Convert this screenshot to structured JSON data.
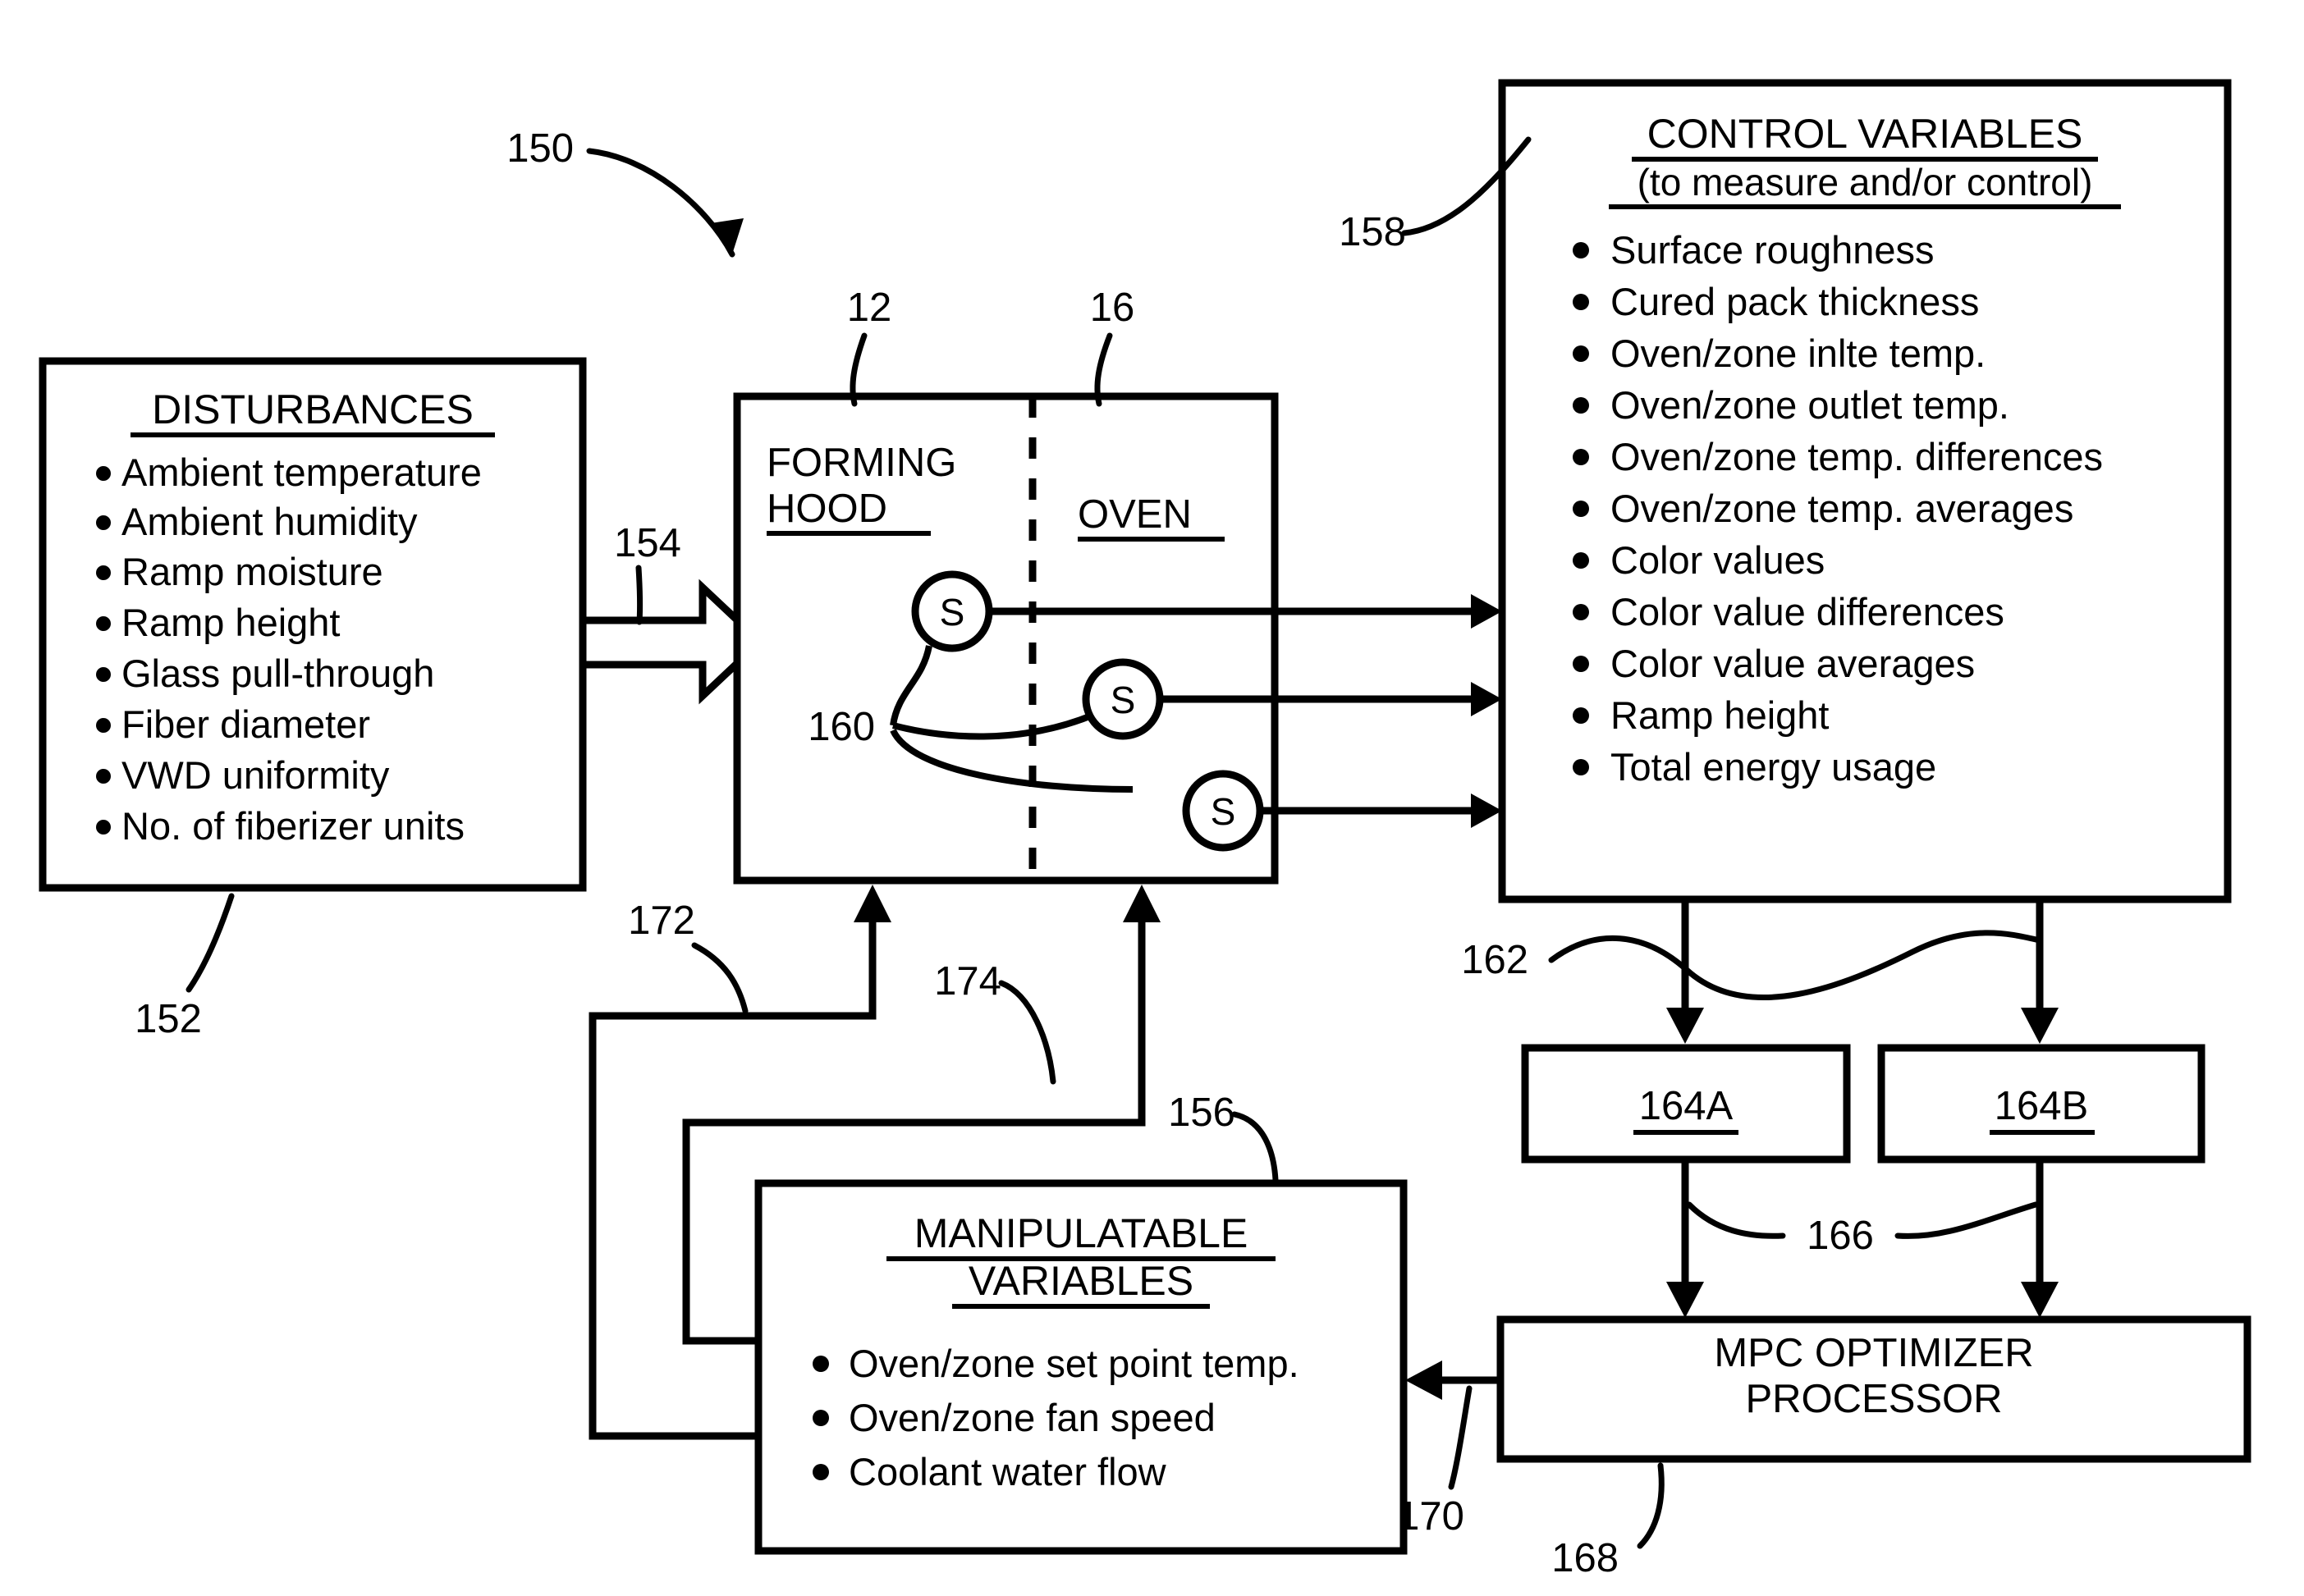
{
  "figure": {
    "reference_numeral": "150"
  },
  "disturbances": {
    "title": "DISTURBANCES",
    "reference_numeral": "152",
    "items": [
      "Ambient temperature",
      "Ambient humidity",
      "Ramp moisture",
      "Ramp height",
      "Glass pull-through",
      "Fiber diameter",
      "VWD uniformity",
      "No. of fiberizer units"
    ]
  },
  "process": {
    "forming_hood_label_line1": "FORMING",
    "forming_hood_label_line2": "HOOD",
    "forming_hood_reference_numeral": "12",
    "oven_label": "OVEN",
    "oven_reference_numeral": "16",
    "sensor_label": "S",
    "sensors_reference_numeral": "160",
    "disturbance_arrow_reference_numeral": "154"
  },
  "control_variables": {
    "title": "CONTROL VARIABLES",
    "subtitle": "(to measure and/or control)",
    "reference_numeral": "158",
    "items": [
      "Surface roughness",
      "Cured pack thickness",
      "Oven/zone inlte temp.",
      "Oven/zone outlet temp.",
      "Oven/zone temp. differences",
      "Oven/zone temp. averages",
      "Color values",
      "Color value differences",
      "Color value averages",
      "Ramp height",
      "Total energy usage"
    ]
  },
  "manipulatable_variables": {
    "title_line1": "MANIPULATABLE",
    "title_line2": "VARIABLES",
    "reference_numeral": "156",
    "items": [
      "Oven/zone set point temp.",
      "Oven/zone fan speed",
      "Coolant water flow"
    ]
  },
  "model_blocks": {
    "block_a_label": "164A",
    "block_b_label": "164B",
    "input_link_reference_numeral": "162",
    "output_link_reference_numeral": "166"
  },
  "optimizer": {
    "label_line1": "MPC OPTIMIZER",
    "label_line2": "PROCESSOR",
    "reference_numeral": "168",
    "output_link_reference_numeral": "170"
  },
  "feedback_links": {
    "hood_feedback_reference_numeral": "172",
    "oven_feedback_reference_numeral": "174"
  },
  "colors": {
    "ink": "#000000",
    "paper": "#ffffff"
  }
}
